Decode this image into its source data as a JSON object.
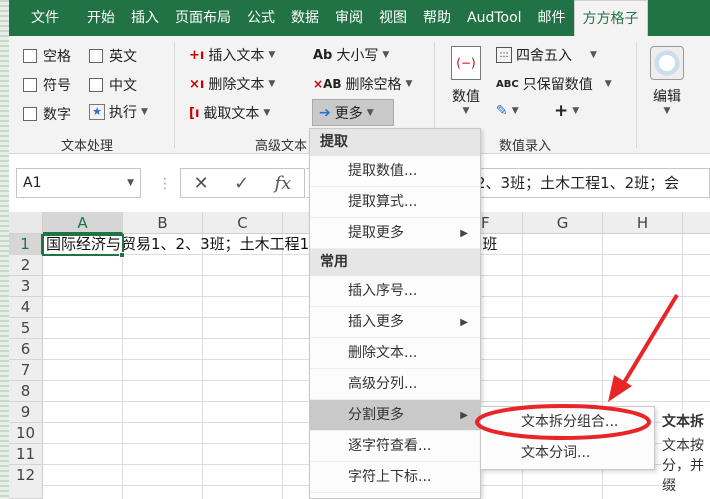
{
  "tabs": [
    "文件",
    "开始",
    "插入",
    "页面布局",
    "公式",
    "数据",
    "审阅",
    "视图",
    "帮助",
    "AudTool",
    "邮件",
    "方方格子"
  ],
  "ribbon": {
    "text_group": {
      "label": "文本处理",
      "checks": [
        "空格",
        "英文",
        "符号",
        "中文",
        "数字"
      ],
      "execute": "执行"
    },
    "adv_group": {
      "label": "高级文本",
      "insert_text": "插入文本",
      "delete_text": "删除文本",
      "extract_text": "截取文本",
      "case": "大小写",
      "delete_space": "删除空格",
      "more": "更多"
    },
    "value_group": {
      "label": "数值录入",
      "round": "四舍五入",
      "keep_value": "只保留数值",
      "value": "数值",
      "plus": "+"
    },
    "edit_group": {
      "label": "编辑"
    }
  },
  "formula_bar": {
    "name_box": "A1",
    "fx": "fx",
    "formula_text": "2、3班；土木工程1、2班；会"
  },
  "grid": {
    "columns": [
      "A",
      "B",
      "C",
      "D",
      "E",
      "F",
      "G",
      "H"
    ],
    "rows": [
      "1",
      "2",
      "3",
      "4",
      "5",
      "6",
      "7",
      "8",
      "9",
      "10",
      "11",
      "12"
    ],
    "a1_text": "国际经济与贸易1、2、3班；土木工程1、2班；财务管理1、2、3班"
  },
  "menu": {
    "head_extract": "提取",
    "extract_items": [
      "提取数值...",
      "提取算式...",
      "提取更多"
    ],
    "head_common": "常用",
    "common_items": [
      "插入序号...",
      "插入更多",
      "删除文本...",
      "高级分列...",
      "分割更多",
      "逐字符查看...",
      "字符上下标..."
    ]
  },
  "submenu": {
    "items": [
      "文本拆分组合...",
      "文本分词..."
    ]
  },
  "tooltip": {
    "title": "文本拆",
    "body": "文本按分，并缀"
  },
  "colors": {
    "excel_green": "#217346",
    "annotation_red": "#e8262a"
  }
}
